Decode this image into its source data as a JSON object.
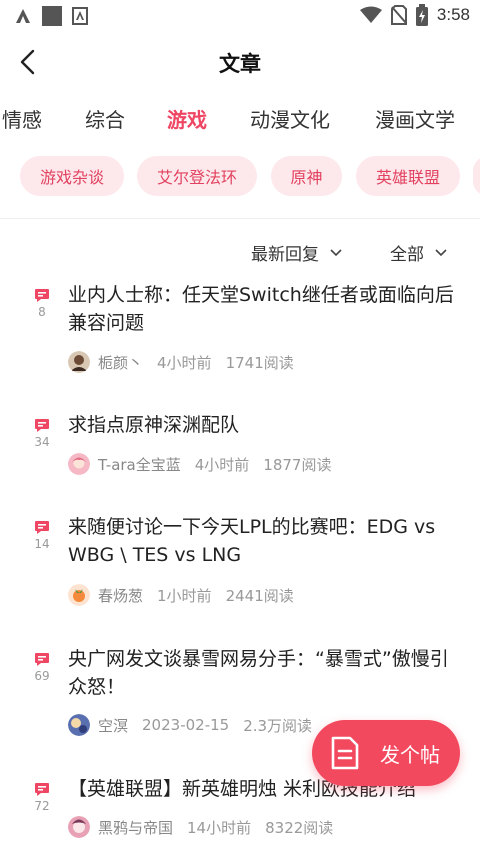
{
  "status_bar": {
    "time": "3:58",
    "icons": [
      "a-logo-icon",
      "square-icon",
      "a-box-icon",
      "wifi-icon",
      "no-sim-icon",
      "battery-charging-icon"
    ]
  },
  "header": {
    "back_icon": "chevron-left-icon",
    "title": "文章"
  },
  "tabs": [
    {
      "label": "情感",
      "active": false
    },
    {
      "label": "综合",
      "active": false
    },
    {
      "label": "游戏",
      "active": true
    },
    {
      "label": "动漫文化",
      "active": false
    },
    {
      "label": "漫画文学",
      "active": false
    }
  ],
  "chips": [
    "游戏杂谈",
    "艾尔登法环",
    "原神",
    "英雄联盟"
  ],
  "sort": {
    "order_label": "最新回复",
    "filter_label": "全部"
  },
  "posts": [
    {
      "replies": "8",
      "title": "业内人士称：任天堂Switch继任者或面临向后兼容问题",
      "author": "栀颜丶",
      "time": "4小时前",
      "views": "1741阅读"
    },
    {
      "replies": "34",
      "title": "求指点原神深渊配队",
      "author": "T-ara全宝蓝",
      "time": "4小时前",
      "views": "1877阅读"
    },
    {
      "replies": "14",
      "title": "来随便讨论一下今天LPL的比赛吧：EDG vs WBG \\ TES vs LNG",
      "author": "春炀葱",
      "time": "1小时前",
      "views": "2441阅读"
    },
    {
      "replies": "69",
      "title": "央广网发文谈暴雪网易分手：“暴雪式”傲慢引众怒！",
      "author": "空溟",
      "time": "2023-02-15",
      "views": "2.3万阅读"
    },
    {
      "replies": "72",
      "title": "【英雄联盟】新英雄明烛 米利欧技能介绍",
      "author": "黑鸦与帝国",
      "time": "14小时前",
      "views": "8322阅读"
    }
  ],
  "fab": {
    "label": "发个帖",
    "icon": "document-icon"
  },
  "colors": {
    "accent": "#ef4664",
    "chip_bg": "#fde8ec",
    "fab_bg": "#f2495f"
  }
}
